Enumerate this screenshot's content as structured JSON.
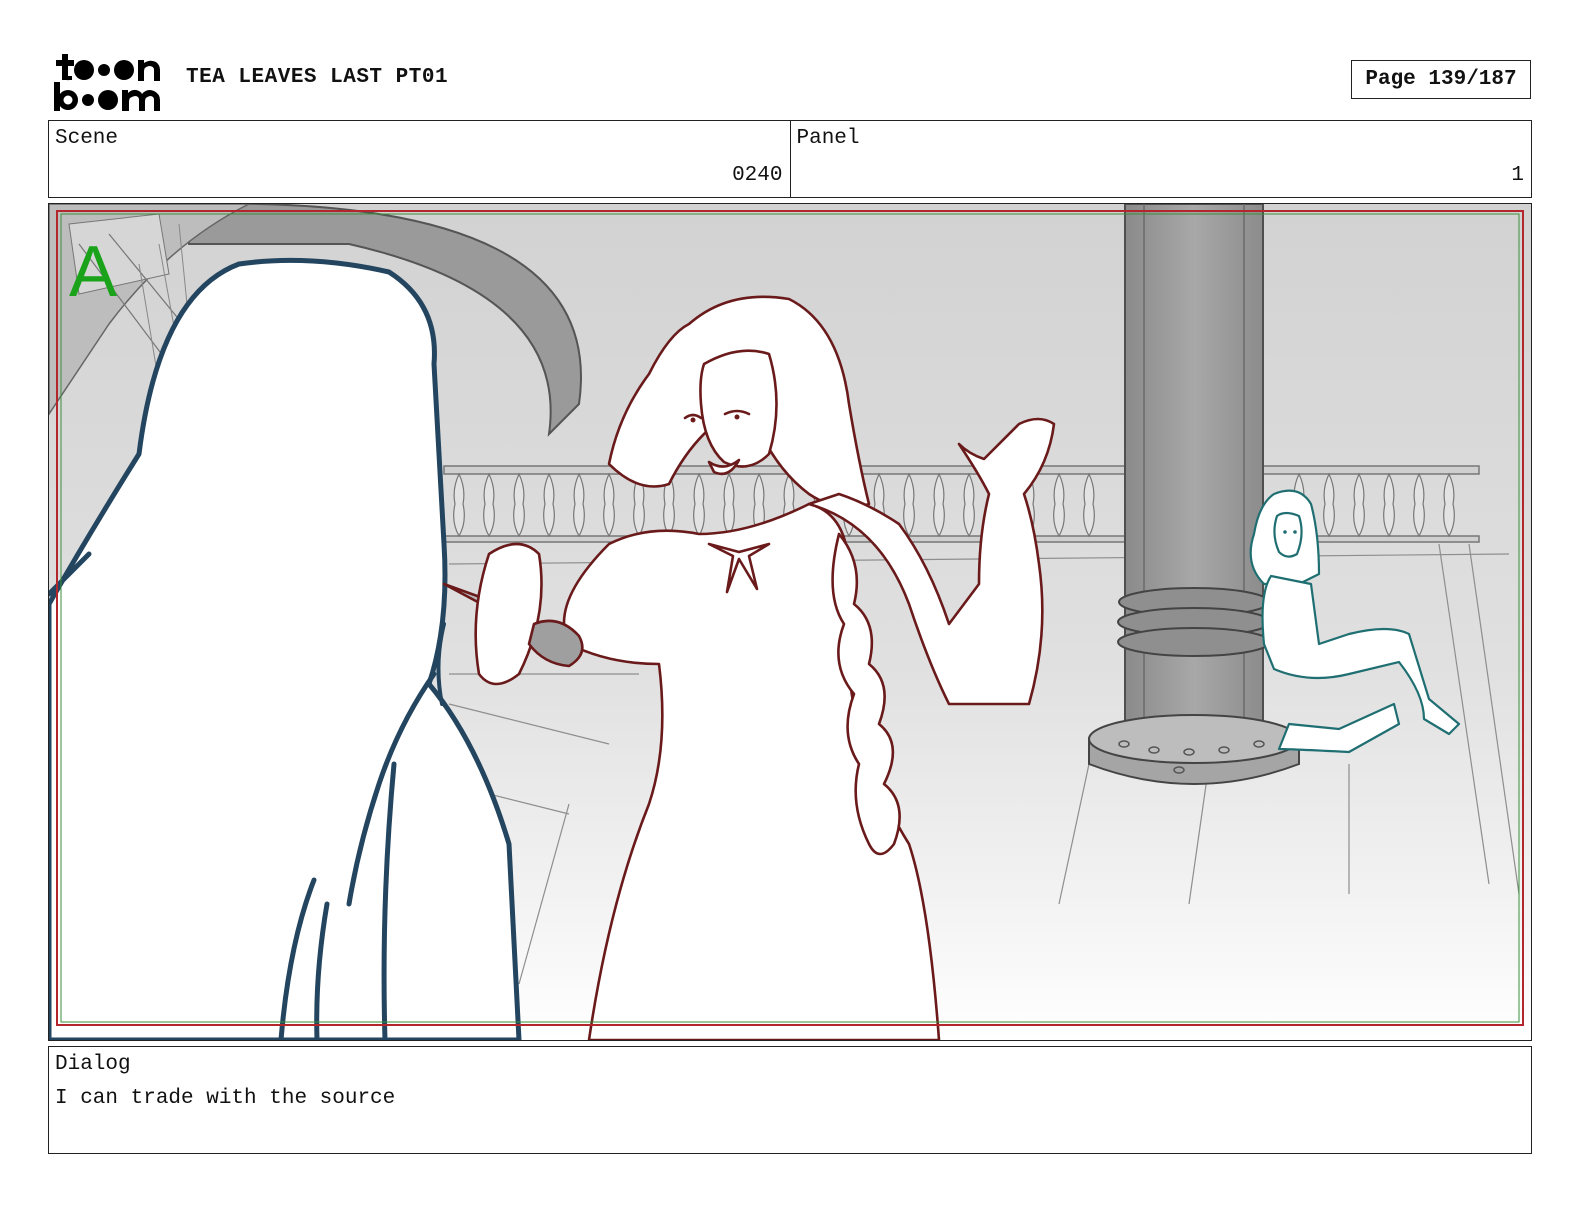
{
  "header": {
    "logo_text": "toon boom",
    "project_title": "TEA LEAVES LAST PT01",
    "page_indicator": "Page 139/187"
  },
  "scene": {
    "label": "Scene",
    "value": "0240"
  },
  "panel": {
    "label": "Panel",
    "value": "1"
  },
  "artwork": {
    "layer_marker": "A"
  },
  "dialog": {
    "label": "Dialog",
    "text": "I can trade with the source"
  },
  "colors": {
    "frame_red": "#b3262b",
    "frame_green": "#3a8f3a",
    "layer_marker_green": "#1aa31a",
    "foreground_figure_blue": "#23455f",
    "main_character_red": "#6a1a1a",
    "background_character_teal": "#1f6f72"
  }
}
